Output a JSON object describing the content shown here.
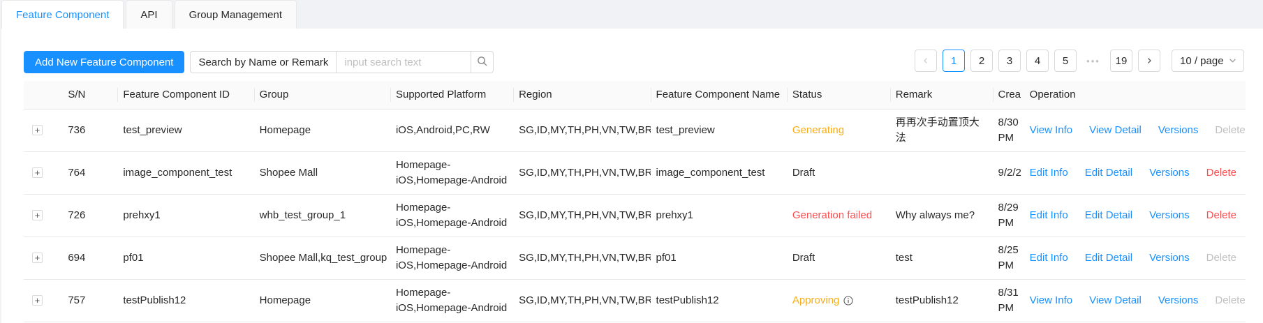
{
  "tabs": [
    {
      "label": "Feature Component",
      "active": true
    },
    {
      "label": "API",
      "active": false
    },
    {
      "label": "Group Management",
      "active": false
    }
  ],
  "toolbar": {
    "add_label": "Add New Feature Component",
    "search_mode": "Search by Name or Remark",
    "search_placeholder": "input search text",
    "search_icon": "search-icon"
  },
  "pagination": {
    "pages": [
      "1",
      "2",
      "3",
      "4",
      "5"
    ],
    "current": "1",
    "ellipsis": "•••",
    "last": "19",
    "page_size": "10 / page",
    "prev_icon": "chevron-left-icon",
    "next_icon": "chevron-right-icon"
  },
  "table": {
    "columns": [
      "",
      "S/N",
      "Feature Component ID",
      "Group",
      "Supported Platform",
      "Region",
      "Feature Component Name",
      "Status",
      "Remark",
      "Crea",
      "Operation"
    ],
    "rows": [
      {
        "sn": "736",
        "id": "test_preview",
        "group": "Homepage",
        "platform": "iOS,Android,PC,RW",
        "region": "SG,ID,MY,TH,PH,VN,TW,BR,MX,CO,CL,PL,ES,AR,FR",
        "name": "test_preview",
        "status": "Generating",
        "remark": "再再次手动置顶大法",
        "created": "8/30 PM",
        "ops": [
          "View Info",
          "View Detail",
          "Versions",
          "Delete"
        ]
      },
      {
        "sn": "764",
        "id": "image_component_test",
        "group": "Shopee Mall",
        "platform": "Homepage-iOS,Homepage-Android",
        "region": "SG,ID,MY,TH,PH,VN,TW,BR,MX,CO,CL,PL,ES,AR,FR",
        "name": "image_component_test",
        "status": "Draft",
        "remark": "",
        "created": "9/2/2",
        "ops": [
          "Edit Info",
          "Edit Detail",
          "Versions",
          "Delete"
        ]
      },
      {
        "sn": "726",
        "id": "prehxy1",
        "group": "whb_test_group_1",
        "platform": "Homepage-iOS,Homepage-Android",
        "region": "SG,ID,MY,TH,PH,VN,TW,BR,MX,CO,CL,PL,ES,AR,FR",
        "name": "prehxy1",
        "status": "Generation failed",
        "remark": "Why always me?",
        "created": "8/29 PM",
        "ops": [
          "Edit Info",
          "Edit Detail",
          "Versions",
          "Delete"
        ]
      },
      {
        "sn": "694",
        "id": "pf01",
        "group": "Shopee Mall,kq_test_group",
        "platform": "Homepage-iOS,Homepage-Android",
        "region": "SG,ID,MY,TH,PH,VN,TW,BR,MX,CO,CL,PL,ES,AR,FR",
        "name": "pf01",
        "status": "Draft",
        "remark": "test",
        "created": "8/25 PM",
        "ops": [
          "Edit Info",
          "Edit Detail",
          "Versions",
          "Delete"
        ]
      },
      {
        "sn": "757",
        "id": "testPublish12",
        "group": "Homepage",
        "platform": "Homepage-iOS,Homepage-Android",
        "region": "SG,ID,MY,TH,PH,VN,TW,BR,MX,CO,CL,PL,ES,AR,FR",
        "name": "testPublish12",
        "status": "Approving",
        "remark": "testPublish12",
        "created": "8/31 PM",
        "ops": [
          "View Info",
          "View Detail",
          "Versions",
          "Delete"
        ]
      }
    ]
  },
  "colors": {
    "primary": "#1890ff",
    "warning": "#faad14",
    "danger": "#ff4d4f",
    "disabled": "#bfbfbf"
  }
}
